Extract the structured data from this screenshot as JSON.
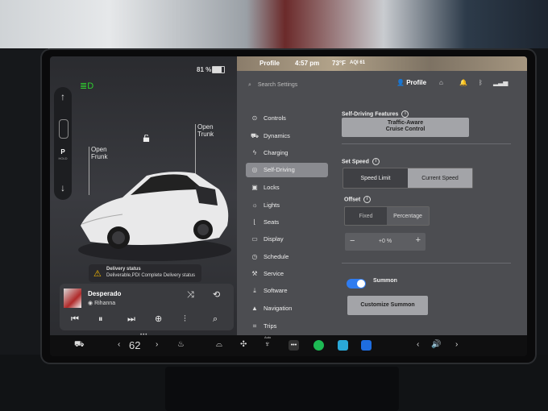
{
  "status": {
    "battery": "81 %",
    "user": "Profile",
    "time": "4:57 pm",
    "temp": "73°F",
    "aqi": "AQI 61"
  },
  "car": {
    "open_frunk": "Open\nFrunk",
    "open_trunk": "Open\nTrunk",
    "gear": "P",
    "hold": "HOLD",
    "delivery_title": "Delivery status",
    "delivery_msg": "Deliverable,PDI Complete Delivery status"
  },
  "media": {
    "song": "Desperado",
    "artist": "Rihanna"
  },
  "search": {
    "placeholder": "Search Settings"
  },
  "header": {
    "profile": "Profile"
  },
  "nav": [
    {
      "label": "Controls",
      "icon": "toggle-icon"
    },
    {
      "label": "Dynamics",
      "icon": "car-icon"
    },
    {
      "label": "Charging",
      "icon": "bolt-icon"
    },
    {
      "label": "Self-Driving",
      "icon": "steering-wheel-icon",
      "active": true
    },
    {
      "label": "Locks",
      "icon": "lock-icon"
    },
    {
      "label": "Lights",
      "icon": "sun-icon"
    },
    {
      "label": "Seats",
      "icon": "seat-icon"
    },
    {
      "label": "Display",
      "icon": "display-icon"
    },
    {
      "label": "Schedule",
      "icon": "clock-icon"
    },
    {
      "label": "Service",
      "icon": "wrench-icon"
    },
    {
      "label": "Software",
      "icon": "download-icon"
    },
    {
      "label": "Navigation",
      "icon": "navigation-icon"
    },
    {
      "label": "Trips",
      "icon": "trips-icon"
    }
  ],
  "self_driving": {
    "features_label": "Self-Driving Features",
    "features_btn_1": "Traffic-Aware",
    "features_btn_2": "Cruise Control",
    "set_speed_label": "Set Speed",
    "speed_limit": "Speed Limit",
    "current_speed": "Current Speed",
    "offset_label": "Offset",
    "fixed": "Fixed",
    "percentage": "Percentage",
    "offset_value": "+0 %",
    "summon_label": "Summon",
    "summon_on": true,
    "customize_summon": "Customize Summon"
  },
  "taskbar": {
    "temperature": "62",
    "auto_label": "Auto"
  },
  "colors": {
    "accent": "#2f7cf0",
    "warning": "#f5b800",
    "spotify": "#1db954",
    "headlight": "#2fd12f"
  }
}
